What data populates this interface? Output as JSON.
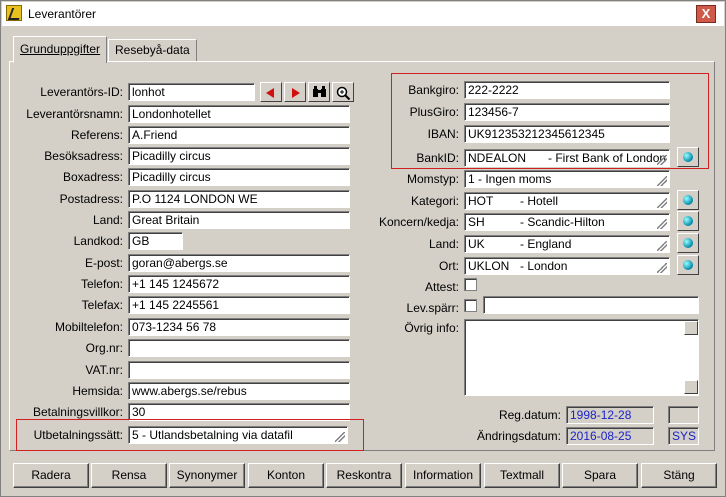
{
  "window": {
    "title": "Leverantörer",
    "close_label": "X"
  },
  "tabs": [
    {
      "label": "Grunduppgifter"
    },
    {
      "label": "Resebyå-data"
    }
  ],
  "left": {
    "leverantors_id": {
      "label": "Leverantörs-ID:",
      "value": "lonhot"
    },
    "namn": {
      "label": "Leverantörsnamn:",
      "value": "Londonhotellet"
    },
    "referens": {
      "label": "Referens:",
      "value": "A.Friend"
    },
    "besoksadress": {
      "label": "Besöksadress:",
      "value": "Picadilly circus"
    },
    "boxadress": {
      "label": "Boxadress:",
      "value": "Picadilly circus"
    },
    "postadress": {
      "label": "Postadress:",
      "value": "P.O 1124 LONDON WE"
    },
    "land": {
      "label": "Land:",
      "value": "Great Britain"
    },
    "landkod": {
      "label": "Landkod:",
      "value": "GB"
    },
    "epost": {
      "label": "E-post:",
      "value": "goran@abergs.se"
    },
    "telefon": {
      "label": "Telefon:",
      "value": "+1 145 1245672"
    },
    "telefax": {
      "label": "Telefax:",
      "value": "+1 145 2245561"
    },
    "mobil": {
      "label": "Mobiltelefon:",
      "value": "073-1234 56 78"
    },
    "orgnr": {
      "label": "Org.nr:",
      "value": ""
    },
    "vatnr": {
      "label": "VAT.nr:",
      "value": ""
    },
    "hemsida": {
      "label": "Hemsida:",
      "value": "www.abergs.se/rebus"
    },
    "betalningsvillkor": {
      "label": "Betalningsvillkor:",
      "value": "30"
    },
    "utbetalningssatt": {
      "label": "Utbetalningssätt:",
      "value": "5  - Utlandsbetalning via datafil"
    }
  },
  "right": {
    "bankgiro": {
      "label": "Bankgiro:",
      "value": "222-2222"
    },
    "plusgiro": {
      "label": "PlusGiro:",
      "value": "123456-7"
    },
    "iban": {
      "label": "IBAN:",
      "value": "UK912353212345612345"
    },
    "bankid": {
      "label": "BankID:",
      "code": "NDEALON",
      "desc": "- First Bank of London"
    },
    "momstyp": {
      "label": "Momstyp:",
      "value": "1  - Ingen moms"
    },
    "kategori": {
      "label": "Kategori:",
      "code": "HOT",
      "desc": "- Hotell"
    },
    "koncern": {
      "label": "Koncern/kedja:",
      "code": "SH",
      "desc": "- Scandic-Hilton"
    },
    "land": {
      "label": "Land:",
      "code": "UK",
      "desc": "- England"
    },
    "ort": {
      "label": "Ort:",
      "code": "UKLON",
      "desc": "- London"
    },
    "attest": {
      "label": "Attest:"
    },
    "levsparr": {
      "label": "Lev.spärr:",
      "value": ""
    },
    "ovriginfo": {
      "label": "Övrig info:",
      "value": ""
    },
    "regdatum": {
      "label": "Reg.datum:",
      "value": "1998-12-28",
      "user": ""
    },
    "andringsdatum": {
      "label": "Ändringsdatum:",
      "value": "2016-08-25",
      "user": "SYS"
    }
  },
  "buttons": [
    {
      "label": "Radera"
    },
    {
      "label": "Rensa"
    },
    {
      "label": "Synonymer"
    },
    {
      "label": "Konton"
    },
    {
      "label": "Reskontra"
    },
    {
      "label": "Information"
    },
    {
      "label": "Textmall"
    },
    {
      "label": "Spara"
    },
    {
      "label": "Stäng"
    }
  ]
}
